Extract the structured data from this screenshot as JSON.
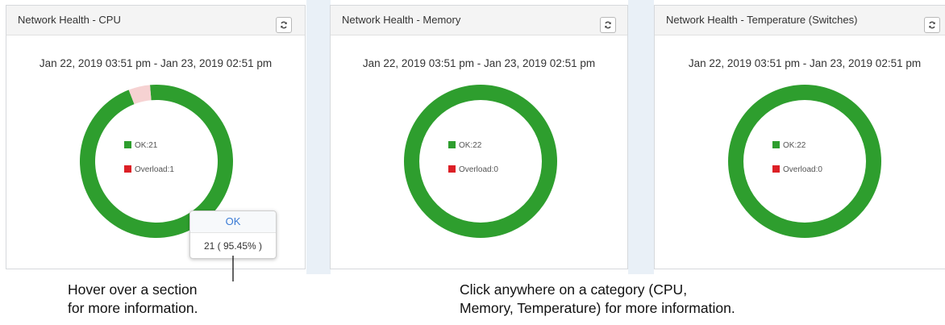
{
  "colors": {
    "ok": "#2e9e2e",
    "overload": "#dc1f26",
    "overload_hover": "#f6d2d2"
  },
  "widgets": [
    {
      "title": "Network Health - CPU",
      "range": "Jan 22, 2019 03:51 pm - Jan 23, 2019 02:51 pm",
      "ok_label": "OK:21",
      "overload_label": "Overload:1",
      "ok": 21,
      "overload": 1
    },
    {
      "title": "Network Health - Memory",
      "range": "Jan 22, 2019 03:51 pm - Jan 23, 2019 02:51 pm",
      "ok_label": "OK:22",
      "overload_label": "Overload:0",
      "ok": 22,
      "overload": 0
    },
    {
      "title": "Network Health - Temperature (Switches)",
      "range": "Jan 22, 2019 03:51 pm - Jan 23, 2019 02:51 pm",
      "ok_label": "OK:22",
      "overload_label": "Overload:0",
      "ok": 22,
      "overload": 0
    }
  ],
  "tooltip": {
    "title": "OK",
    "value": "21 ( 95.45% )"
  },
  "captions": {
    "hover_line1": "Hover over a section",
    "hover_line2": "for more information.",
    "click_line1": "Click anywhere on a category (CPU,",
    "click_line2": "Memory, Temperature) for more information."
  }
}
